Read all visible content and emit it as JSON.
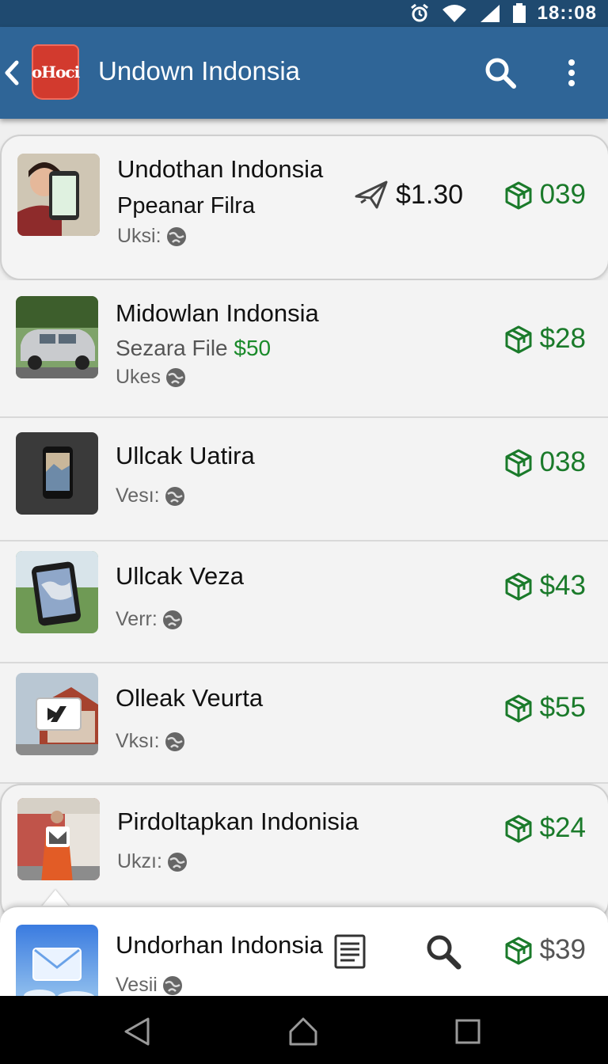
{
  "status": {
    "time": "18::08"
  },
  "appbar": {
    "title": "Undown Indonsia",
    "logo_text": "oHoci"
  },
  "items": [
    {
      "title": "Undothan Indonsia",
      "sub": "Ppeanar Filra",
      "meta": "Uksi:",
      "send_price": "$1.30",
      "price": "039"
    },
    {
      "title": "Midowlan Indonsia",
      "sub": "Sezara File",
      "sub_price": "$50",
      "meta": "Ukes",
      "price": "$28"
    },
    {
      "title": "Ullcak Uatira",
      "meta": "Vesı:",
      "price": "038"
    },
    {
      "title": "Ullcak  Veza",
      "meta": "Verr:",
      "price": "$43"
    },
    {
      "title": "Olleak  Veurta",
      "meta": "Vksı:",
      "price": "$55"
    },
    {
      "title": "Pirdoltapkan Indonisia",
      "meta": "Ukzı:",
      "price": "$24"
    },
    {
      "title": "Undorhan Indonsia",
      "meta": "Vesii",
      "price": "$39"
    }
  ],
  "colors": {
    "appbar": "#2f6597",
    "statusbar": "#1f4a70",
    "price_green": "#1a7a2a",
    "accent_green": "#1a8a2a"
  }
}
